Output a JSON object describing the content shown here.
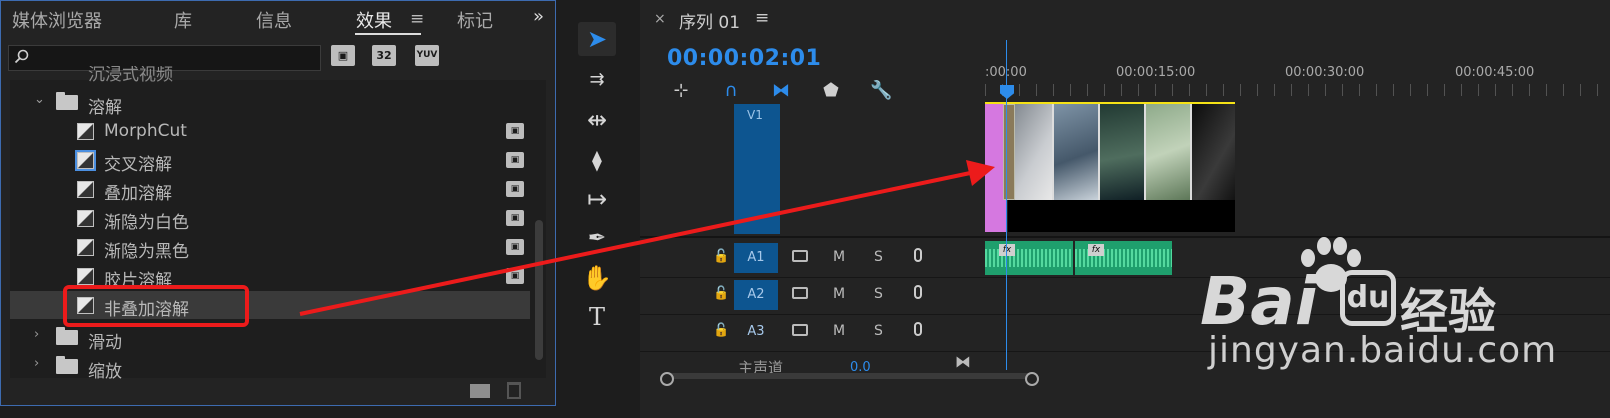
{
  "effects_panel": {
    "tabs": [
      "媒体浏览器",
      "库",
      "信息",
      "效果",
      "标记"
    ],
    "active_tab": "效果",
    "more_label": "»",
    "search": {
      "value": "",
      "placeholder": ""
    },
    "accel_icons": [
      "accelerated-effects-icon",
      "32-bit-icon",
      "yuv-icon"
    ],
    "accel_labels": [
      "",
      "32",
      "YUV"
    ],
    "partial_row": "沉浸式视频",
    "folder_open": "溶解",
    "items": [
      "MorphCut",
      "交叉溶解",
      "叠加溶解",
      "渐隐为白色",
      "渐隐为黑色",
      "胶片溶解",
      "非叠加溶解"
    ],
    "selected_item": "非叠加溶解",
    "folders_closed": [
      "滑动",
      "缩放"
    ]
  },
  "tools": [
    "selection-tool-icon",
    "track-select-icon",
    "ripple-edit-icon",
    "razor-icon",
    "slip-icon",
    "pen-icon",
    "hand-icon",
    "type-icon"
  ],
  "timeline": {
    "sequence_title": "序列 01",
    "timecode": "00:00:02:01",
    "ruler": [
      ":00:00",
      "00:00:15:00",
      "00:00:30:00",
      "00:00:45:00"
    ],
    "video_track": "V1",
    "audio_tracks": [
      {
        "name": "A1",
        "m": "M",
        "s": "S"
      },
      {
        "name": "A2",
        "m": "M",
        "s": "S"
      },
      {
        "name": "A3",
        "m": "M",
        "s": "S"
      }
    ],
    "master_label": "主声道",
    "master_value": "0.0",
    "fx_badge": "fx"
  },
  "watermark": {
    "bai": "Bai",
    "du": "du",
    "jingyan": "经验",
    "url": "jingyan.baidu.com"
  },
  "colors": {
    "accent": "#2d8ceb",
    "annotation": "#ec1b1b",
    "workarea": "#f5e216",
    "audio_clip": "#1f9f6d",
    "pink_clip": "#d578e0"
  }
}
